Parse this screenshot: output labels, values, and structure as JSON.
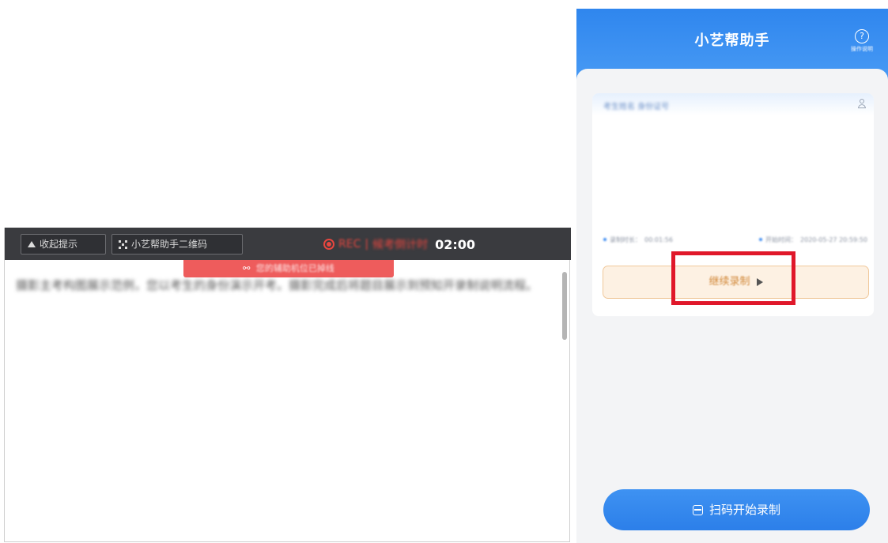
{
  "exam_toolbar": {
    "collapse_label": "收起提示",
    "qrcode_label": "小艺帮助手二维码",
    "rec_label": "REC",
    "separator": "|",
    "countdown_label": "候考倒计时",
    "countdown_value": "02:00",
    "notice_text": "您的辅助机位已掉线"
  },
  "exam_content": {
    "text": "摄影主考构图展示范例，您以考生的身份演示开考。摄影完成后将题目展示到预知开录制说明流程。"
  },
  "phone": {
    "title": "小艺帮助手",
    "help_label": "操作说明",
    "card": {
      "name": "考生姓名 身份证号",
      "duration_label": "录制时长：",
      "duration_value": "00:01:56",
      "start_label": "开始时间：",
      "start_value": "2020-05-27 20:59:50",
      "continue_label": "继续录制"
    },
    "scan_label": "扫码开始录制"
  },
  "icons": {
    "collapse": "triangle-up-icon",
    "qrcode": "qrcode-icon",
    "rec": "record-icon",
    "notice": "link-icon",
    "help": "help-icon",
    "user": "user-icon",
    "play": "play-icon",
    "scan": "scan-icon"
  },
  "colors": {
    "toolbar_bg": "#3a3b3f",
    "rec_red": "#e8463f",
    "notice_red": "#ee5c5c",
    "phone_blue": "#2f86ee",
    "continue_bg": "#fdf1e3",
    "highlight_red": "#e0182a"
  }
}
